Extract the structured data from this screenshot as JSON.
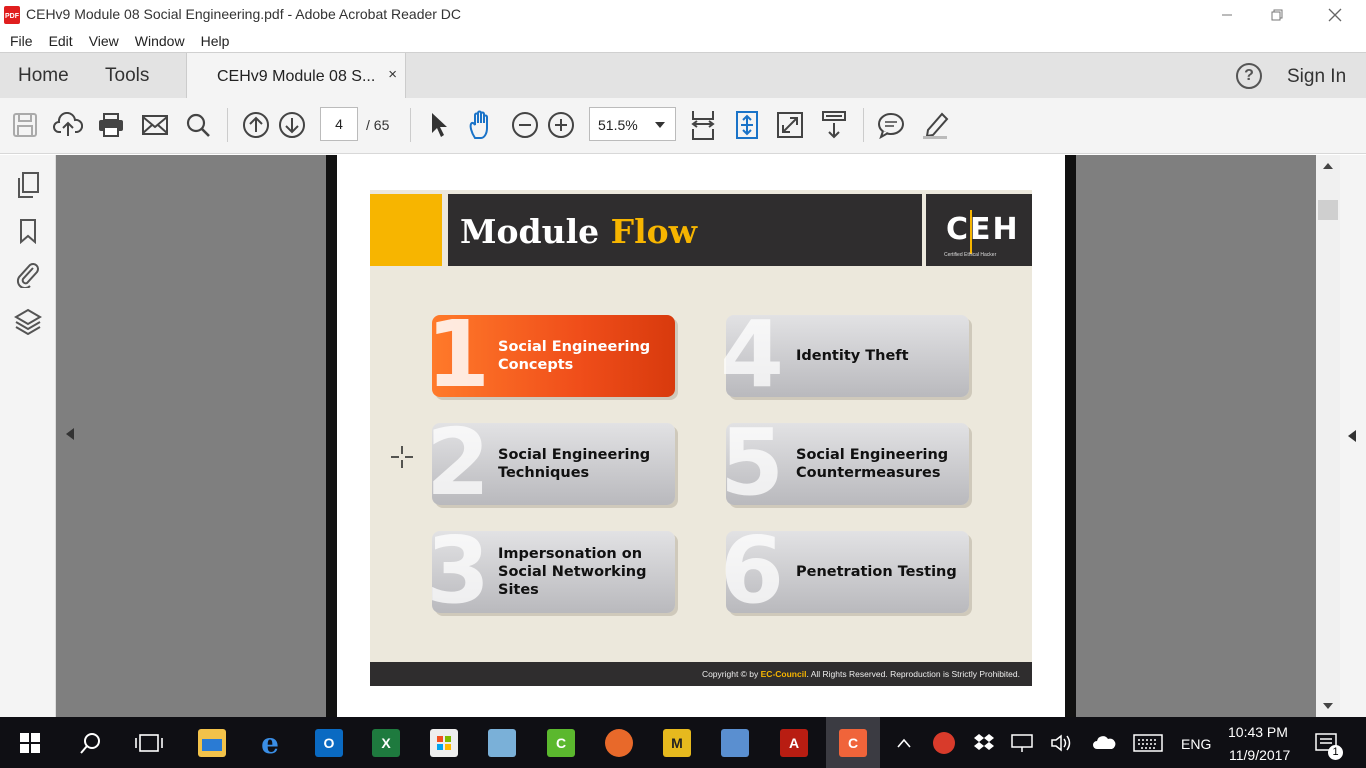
{
  "window": {
    "title": "CEHv9 Module 08 Social Engineering.pdf - Adobe Acrobat Reader DC",
    "pdf_badge": "PDF"
  },
  "menu": [
    "File",
    "Edit",
    "View",
    "Window",
    "Help"
  ],
  "tabs": {
    "home": "Home",
    "tools": "Tools",
    "document": "CEHv9 Module 08 S...",
    "close": "×",
    "help": "?",
    "sign_in": "Sign In"
  },
  "toolbar": {
    "current_page": "4",
    "page_total": "/ 65",
    "zoom": "51.5%"
  },
  "slide": {
    "title_main": "Module ",
    "title_accent": "Flow",
    "logo_text": "CEH",
    "logo_sub": "Certified Ethical Hacker",
    "modules": [
      {
        "num": "1",
        "label": "Social Engineering\nConcepts"
      },
      {
        "num": "2",
        "label": "Social Engineering\nTechniques"
      },
      {
        "num": "3",
        "label": "Impersonation on\nSocial Networking\nSites"
      },
      {
        "num": "4",
        "label": "Identity Theft"
      },
      {
        "num": "5",
        "label": "Social Engineering\nCountermeasures"
      },
      {
        "num": "6",
        "label": "Penetration Testing"
      }
    ],
    "footer_prefix": "Copyright © by ",
    "footer_brand": "EC-Council",
    "footer_suffix": ". All Rights Reserved. Reproduction is Strictly Prohibited."
  },
  "taskbar": {
    "language": "ENG",
    "time": "10:43 PM",
    "date": "11/9/2017",
    "notification_count": "1"
  },
  "colors": {
    "accent_yellow": "#f7b500",
    "active_module": "#f04e1a",
    "slide_dark": "#2f2d2e"
  }
}
